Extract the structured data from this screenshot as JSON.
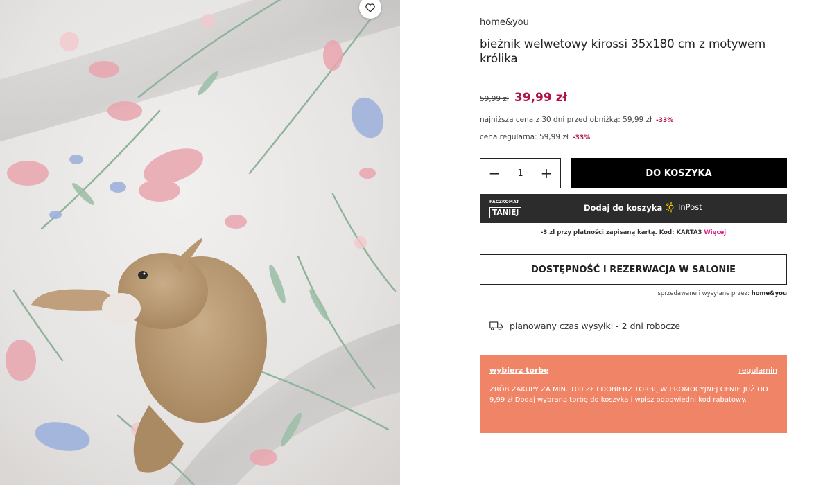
{
  "product": {
    "brand": "home&you",
    "title": "bieżnik welwetowy kirossi 35x180 cm z motywem królika",
    "image_alt": "bieżnik welwetowy z motywem królika",
    "price": {
      "old": "59,99 zł",
      "current": "39,99 zł",
      "lowest_30_days_label": "najniższa cena z 30 dni przed obniżką: 59,99 zł",
      "lowest_30_days_pct": "-33%",
      "regular_label": "cena regularna: 59,99 zł",
      "regular_pct": "-33%"
    }
  },
  "cart": {
    "qty_minus": "−",
    "qty_value": "1",
    "qty_plus": "+",
    "add_to_cart_label": "DO KOSZYKA"
  },
  "inpost": {
    "badge_top": "PACZKOMAT",
    "badge_main": "TANIEJ",
    "label": "Dodaj do koszyka",
    "logo_text": "InPost"
  },
  "promo_code": {
    "text": "-3 zł przy płatności zapisaną kartą. Kod: KARTA3",
    "more_link": "Więcej"
  },
  "store": {
    "button_label": "DOSTĘPNOŚĆ I REZERWACJA W SALONIE",
    "seller_prefix": "sprzedawane i wysyłane przez:",
    "seller_name": "home&you"
  },
  "shipping": {
    "text": "planowany czas wysyłki - 2 dni robocze"
  },
  "bag_offer": {
    "title_link": "wybierz torbę",
    "rules_link": "regulamin",
    "text": "ZRÓB ZAKUPY ZA MIN. 100 ZŁ I DOBIERZ TORBĘ W PROMOCYJNEJ CENIE JUŻ OD 9,99 zł Dodaj wybraną torbę do koszyka i wpisz odpowiedni kod rabatowy."
  },
  "colors": {
    "accent_price": "#b2124a",
    "link_pink": "#d8247c",
    "bag_box": "#f08467",
    "cart_button": "#000000",
    "inpost_bar": "#2c2c2c",
    "inpost_logo": "#ffcb05"
  },
  "icons": {
    "favorite": "heart-icon",
    "shipping": "delivery-truck-icon",
    "inpost": "inpost-sun-icon"
  }
}
